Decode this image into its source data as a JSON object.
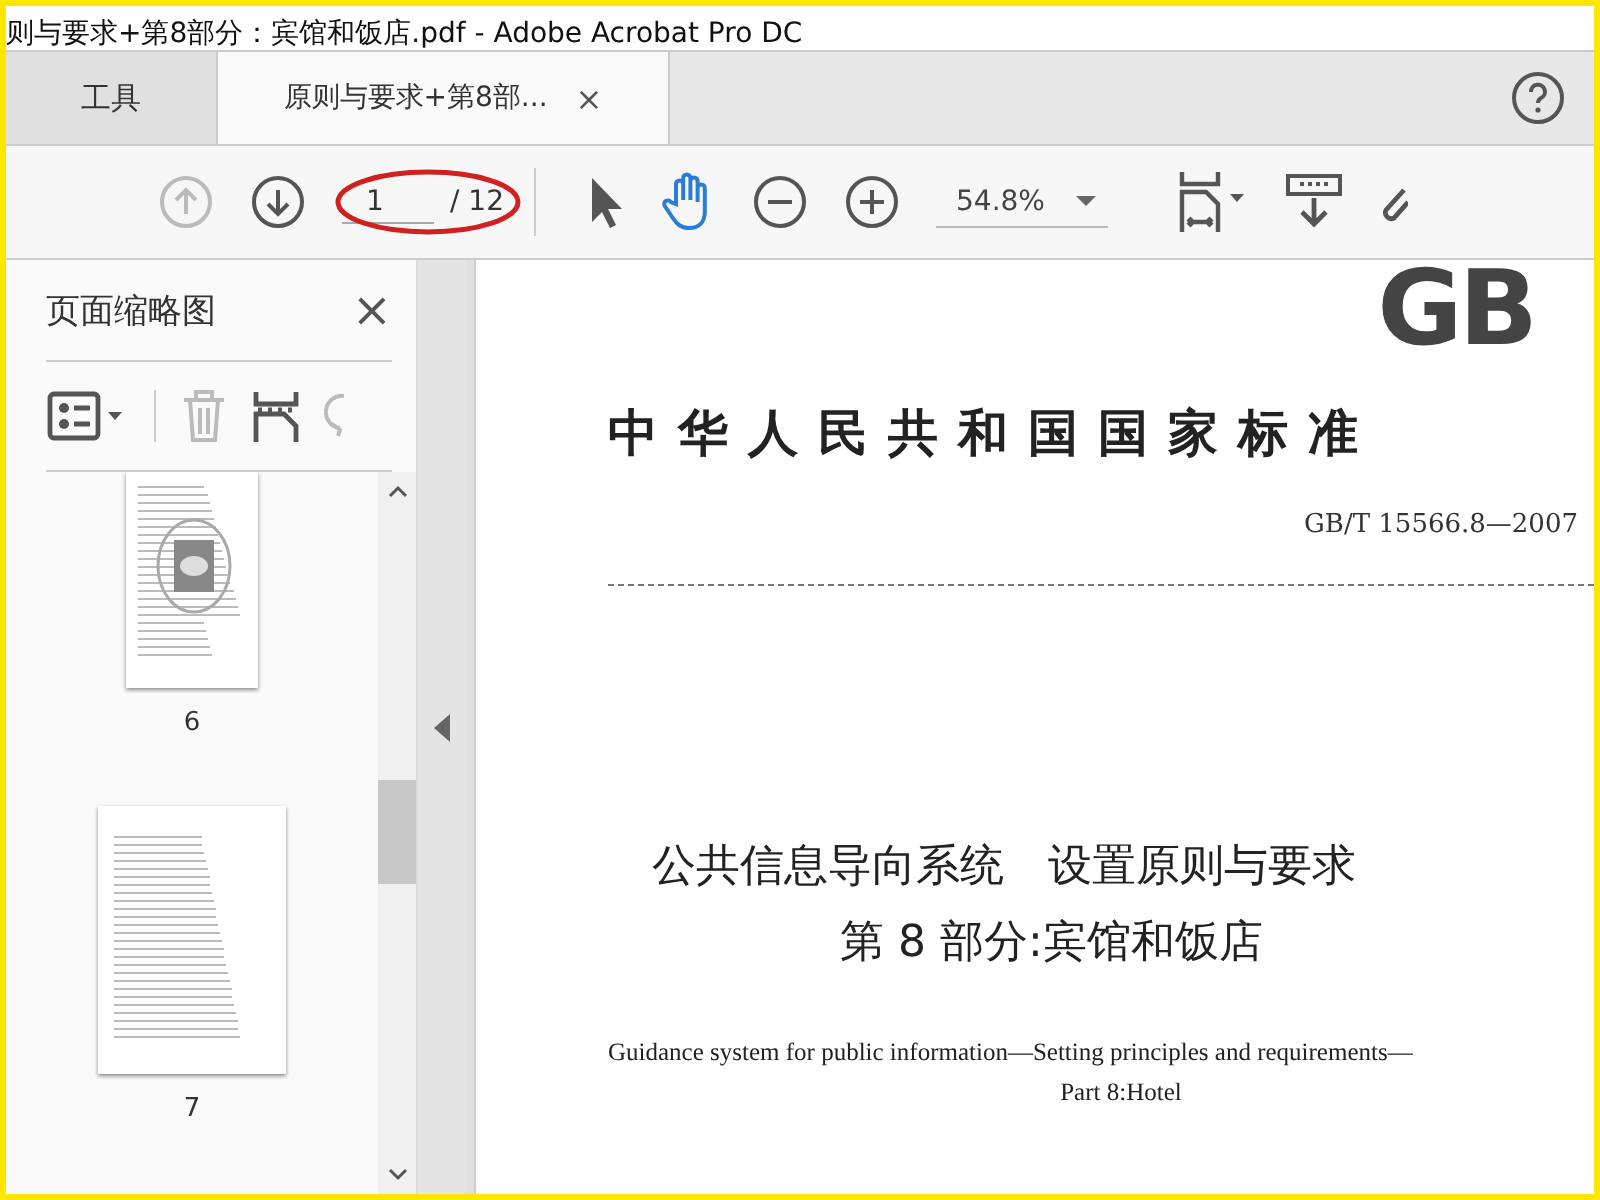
{
  "window": {
    "title": "则与要求+第8部分：宾馆和饭店.pdf - Adobe Acrobat Pro DC"
  },
  "tabs": [
    {
      "label": "工具",
      "selected": false
    },
    {
      "label": "原则与要求+第8部...",
      "selected": true,
      "close": "×"
    }
  ],
  "toolbar": {
    "page": {
      "value": "1",
      "total": "/ 12",
      "circled": true
    },
    "zoom": "54.8%"
  },
  "sidebar": {
    "title": "页面缩略图",
    "close": "×",
    "thumbnails": [
      {
        "label": "6"
      },
      {
        "label": "7"
      }
    ]
  },
  "document": {
    "logo": "GB",
    "heading": "中华人民共和国国家标准",
    "code": "GB/T 15566.8—2007",
    "title_lines": [
      "公共信息导向系统　设置原则与要求",
      "第 8 部分:宾馆和饭店"
    ],
    "english_lines": [
      "Guidance system for public information—Setting principles and requirements—",
      "Part 8:Hotel"
    ]
  }
}
